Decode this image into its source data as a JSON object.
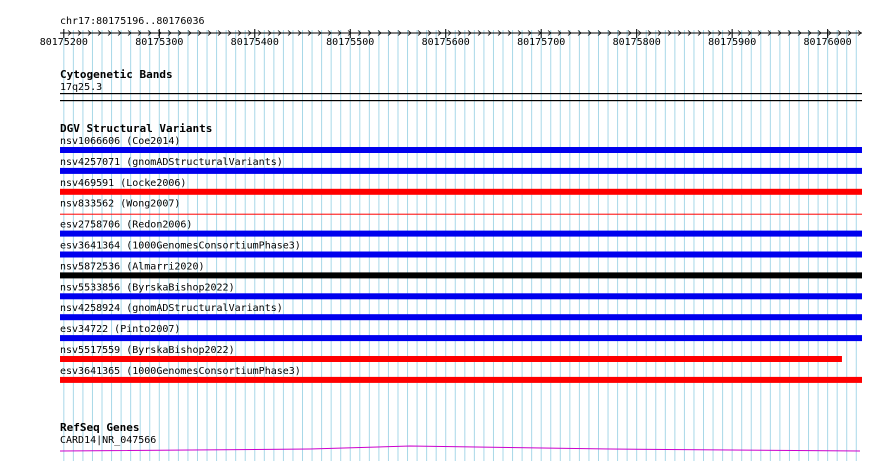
{
  "browser": {
    "location": "chr17:80175196..80176036",
    "ruler": {
      "start": 80175196,
      "end": 80176036,
      "ticks": [
        "80175200",
        "80175300",
        "80175400",
        "80175500",
        "80175600",
        "80175700",
        "80175800",
        "80175900",
        "80176000"
      ]
    }
  },
  "tracks": {
    "cytogenetic": {
      "title": "Cytogenetic Bands",
      "band": "17q25.3"
    },
    "dgv": {
      "title": "DGV Structural Variants",
      "colors": {
        "blue": "#0000ee",
        "red": "#ff0000",
        "black": "#000000"
      },
      "features": [
        {
          "label": "nsv1066606 (Coe2014)",
          "color": "blue",
          "style": "bar",
          "end": 80176036
        },
        {
          "label": "nsv4257071 (gnomADStructuralVariants)",
          "color": "blue",
          "style": "bar",
          "end": 80176036
        },
        {
          "label": "nsv469591 (Locke2006)",
          "color": "red",
          "style": "bar",
          "end": 80176036
        },
        {
          "label": "nsv833562 (Wong2007)",
          "color": "red",
          "style": "line",
          "end": 80176036
        },
        {
          "label": "esv2758706 (Redon2006)",
          "color": "blue",
          "style": "bar",
          "end": 80176036
        },
        {
          "label": "esv3641364 (1000GenomesConsortiumPhase3)",
          "color": "blue",
          "style": "bar",
          "end": 80176036
        },
        {
          "label": "nsv5872536 (Almarri2020)",
          "color": "black",
          "style": "bar",
          "end": 80176036
        },
        {
          "label": "nsv5533856 (ByrskaBishop2022)",
          "color": "blue",
          "style": "bar",
          "end": 80176036
        },
        {
          "label": "nsv4258924 (gnomADStructuralVariants)",
          "color": "blue",
          "style": "bar",
          "end": 80176036
        },
        {
          "label": "esv34722 (Pinto2007)",
          "color": "blue",
          "style": "bar",
          "end": 80176036
        },
        {
          "label": "nsv5517559 (ByrskaBishop2022)",
          "color": "red",
          "style": "bar",
          "end": 80176015
        },
        {
          "label": "esv3641365 (1000GenomesConsortiumPhase3)",
          "color": "red",
          "style": "bar",
          "end": 80176036
        }
      ]
    },
    "refseq": {
      "title": "RefSeq Genes",
      "gene": "CARD14|NR_047566",
      "color": "#cc00cc"
    }
  }
}
